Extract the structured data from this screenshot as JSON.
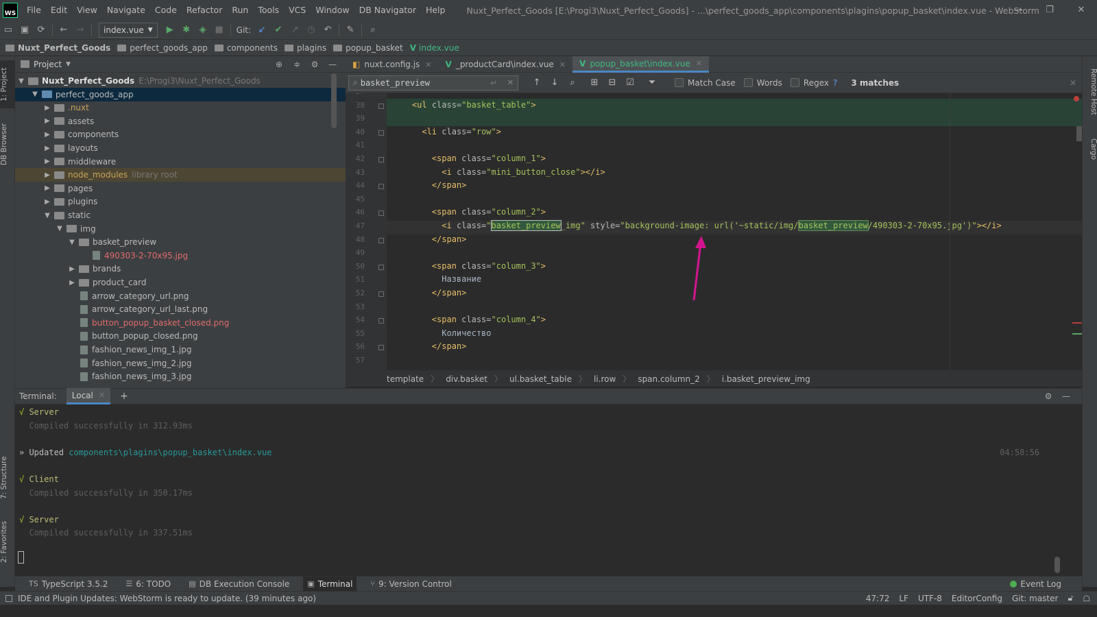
{
  "app": {
    "menu": [
      "File",
      "Edit",
      "View",
      "Navigate",
      "Code",
      "Refactor",
      "Run",
      "Tools",
      "VCS",
      "Window",
      "DB Navigator",
      "Help"
    ],
    "title": "Nuxt_Perfect_Goods [E:\\Progi3\\Nuxt_Perfect_Goods] - ...\\perfect_goods_app\\components\\plagins\\popup_basket\\index.vue - WebStorm",
    "logo": "WS"
  },
  "toolbar": {
    "run_config": "index.vue",
    "git_label": "Git:"
  },
  "navbar": [
    "Nuxt_Perfect_Goods",
    "perfect_goods_app",
    "components",
    "plagins",
    "popup_basket",
    "index.vue"
  ],
  "leftstripe": {
    "project": "1: Project",
    "db": "DB Browser",
    "structure": "7: Structure",
    "favorites": "2: Favorites"
  },
  "rightstripe": {
    "remote": "Remote Host",
    "cargo": "Cargo"
  },
  "project": {
    "title": "Project",
    "root_name": "Nuxt_Perfect_Goods",
    "root_path": "E:\\Progi3\\Nuxt_Perfect_Goods",
    "items": [
      {
        "label": "perfect_goods_app",
        "kind": "folder",
        "level": 1,
        "expanded": true,
        "style": "selected"
      },
      {
        "label": ".nuxt",
        "kind": "folder",
        "level": 2,
        "style": "orange"
      },
      {
        "label": "assets",
        "kind": "folder",
        "level": 2
      },
      {
        "label": "components",
        "kind": "folder",
        "level": 2
      },
      {
        "label": "layouts",
        "kind": "folder",
        "level": 2
      },
      {
        "label": "middleware",
        "kind": "folder",
        "level": 2
      },
      {
        "label": "node_modules",
        "kind": "folder",
        "level": 2,
        "style": "lib",
        "extra": "library root"
      },
      {
        "label": "pages",
        "kind": "folder",
        "level": 2
      },
      {
        "label": "plugins",
        "kind": "folder",
        "level": 2
      },
      {
        "label": "static",
        "kind": "folder",
        "level": 2,
        "expanded": true
      },
      {
        "label": "img",
        "kind": "folder",
        "level": 3,
        "expanded": true
      },
      {
        "label": "basket_preview",
        "kind": "folder",
        "level": 4,
        "expanded": true
      },
      {
        "label": "490303-2-70x95.jpg",
        "kind": "file",
        "level": 5,
        "style": "red"
      },
      {
        "label": "brands",
        "kind": "folder",
        "level": 4
      },
      {
        "label": "product_card",
        "kind": "folder",
        "level": 4
      },
      {
        "label": "arrow_category_url.png",
        "kind": "file",
        "level": 4
      },
      {
        "label": "arrow_category_url_last.png",
        "kind": "file",
        "level": 4
      },
      {
        "label": "button_popup_basket_closed.png",
        "kind": "file",
        "level": 4,
        "style": "red"
      },
      {
        "label": "button_popup_closed.png",
        "kind": "file",
        "level": 4
      },
      {
        "label": "fashion_news_img_1.jpg",
        "kind": "file",
        "level": 4
      },
      {
        "label": "fashion_news_img_2.jpg",
        "kind": "file",
        "level": 4
      },
      {
        "label": "fashion_news_img_3.jpg",
        "kind": "file",
        "level": 4
      }
    ]
  },
  "tabs": [
    {
      "label": "nuxt.config.js",
      "icon": "JS"
    },
    {
      "label": "_productCard\\index.vue",
      "icon": "V"
    },
    {
      "label": "popup_basket\\index.vue",
      "icon": "V",
      "active": true
    }
  ],
  "find": {
    "query": "basket_preview",
    "match_case": "Match Case",
    "words": "Words",
    "regex": "Regex",
    "help": "?",
    "matches": "3 matches"
  },
  "editor": {
    "lines": [
      {
        "n": "37",
        "html": ""
      },
      {
        "n": "38",
        "html": "    <span class='tag'>&lt;ul </span><span class='attr'>class=</span><span class='str'>\"basket_table\"</span><span class='tag'>&gt;</span>"
      },
      {
        "n": "39",
        "html": ""
      },
      {
        "n": "40",
        "html": "      <span class='tag'>&lt;li </span><span class='attr'>class=</span><span class='str'>\"row\"</span><span class='tag'>&gt;</span>"
      },
      {
        "n": "41",
        "html": ""
      },
      {
        "n": "42",
        "html": "        <span class='tag'>&lt;span </span><span class='attr'>class=</span><span class='str'>\"column_1\"</span><span class='tag'>&gt;</span>"
      },
      {
        "n": "43",
        "html": "          <span class='tag'>&lt;i </span><span class='attr'>class=</span><span class='str'>\"mini_button_close\"</span><span class='tag'>&gt;&lt;/i&gt;</span>"
      },
      {
        "n": "44",
        "html": "        <span class='tag'>&lt;/span&gt;</span>"
      },
      {
        "n": "45",
        "html": ""
      },
      {
        "n": "46",
        "html": "        <span class='tag'>&lt;span </span><span class='attr'>class=</span><span class='str'>\"column_2\"</span><span class='tag'>&gt;</span>"
      },
      {
        "n": "47",
        "html": "          <span class='tag'>&lt;i </span><span class='attr'>class=</span><span class='str'>\"<span class='hl hl2'>basket_preview</span>_img\"</span> <span class='attr'>style=</span><span class='str'>\"background-image: url('~static/img/<span class='hl'>basket_preview</span>/490303-2-70x95.jpg')\"</span><span class='tag'>&gt;&lt;/i&gt;</span>"
      },
      {
        "n": "48",
        "html": "        <span class='tag'>&lt;/span&gt;</span>"
      },
      {
        "n": "49",
        "html": ""
      },
      {
        "n": "50",
        "html": "        <span class='tag'>&lt;span </span><span class='attr'>class=</span><span class='str'>\"column_3\"</span><span class='tag'>&gt;</span>"
      },
      {
        "n": "51",
        "html": "          <span class='txt'>Название</span>"
      },
      {
        "n": "52",
        "html": "        <span class='tag'>&lt;/span&gt;</span>"
      },
      {
        "n": "53",
        "html": ""
      },
      {
        "n": "54",
        "html": "        <span class='tag'>&lt;span </span><span class='attr'>class=</span><span class='str'>\"column_4\"</span><span class='tag'>&gt;</span>"
      },
      {
        "n": "55",
        "html": "          <span class='txt'>Количество</span>"
      },
      {
        "n": "56",
        "html": "        <span class='tag'>&lt;/span&gt;</span>"
      },
      {
        "n": "57",
        "html": ""
      }
    ]
  },
  "edcrumb": [
    "template",
    "div.basket",
    "ul.basket_table",
    "li.row",
    "span.column_2",
    "i.basket_preview_img"
  ],
  "terminal": {
    "label": "Terminal:",
    "tab": "Local",
    "lines": [
      {
        "parts": [
          {
            "c": "ok",
            "t": "√ "
          },
          {
            "c": "y",
            "t": "Server"
          }
        ]
      },
      {
        "parts": [
          {
            "c": "gray",
            "t": "  Compiled successfully in 312.93ms"
          }
        ]
      },
      {
        "parts": []
      },
      {
        "parts": [
          {
            "c": "w",
            "t": "» Updated "
          },
          {
            "c": "cyan",
            "t": "components\\plagins\\popup_basket\\index.vue"
          }
        ]
      },
      {
        "parts": []
      },
      {
        "parts": [
          {
            "c": "ok",
            "t": "√ "
          },
          {
            "c": "y",
            "t": "Client"
          }
        ]
      },
      {
        "parts": [
          {
            "c": "gray",
            "t": "  Compiled successfully in 350.17ms"
          }
        ]
      },
      {
        "parts": []
      },
      {
        "parts": [
          {
            "c": "ok",
            "t": "√ "
          },
          {
            "c": "y",
            "t": "Server"
          }
        ]
      },
      {
        "parts": [
          {
            "c": "gray",
            "t": "  Compiled successfully in 337.51ms"
          }
        ]
      }
    ],
    "time": "04:58:56"
  },
  "tooltabs": [
    {
      "label": "TypeScript 3.5.2",
      "icon": "TS"
    },
    {
      "label": "6: TODO",
      "icon": "☰"
    },
    {
      "label": "DB Execution Console",
      "icon": "▤"
    },
    {
      "label": "Terminal",
      "icon": "▣",
      "active": true
    },
    {
      "label": "9: Version Control",
      "icon": "⑂"
    }
  ],
  "event_log": "Event Log",
  "status": {
    "message": "IDE and Plugin Updates: WebStorm is ready to update. (39 minutes ago)",
    "position": "47:72",
    "eol": "LF",
    "encoding": "UTF-8",
    "config": "EditorConfig",
    "git": "Git: master"
  }
}
